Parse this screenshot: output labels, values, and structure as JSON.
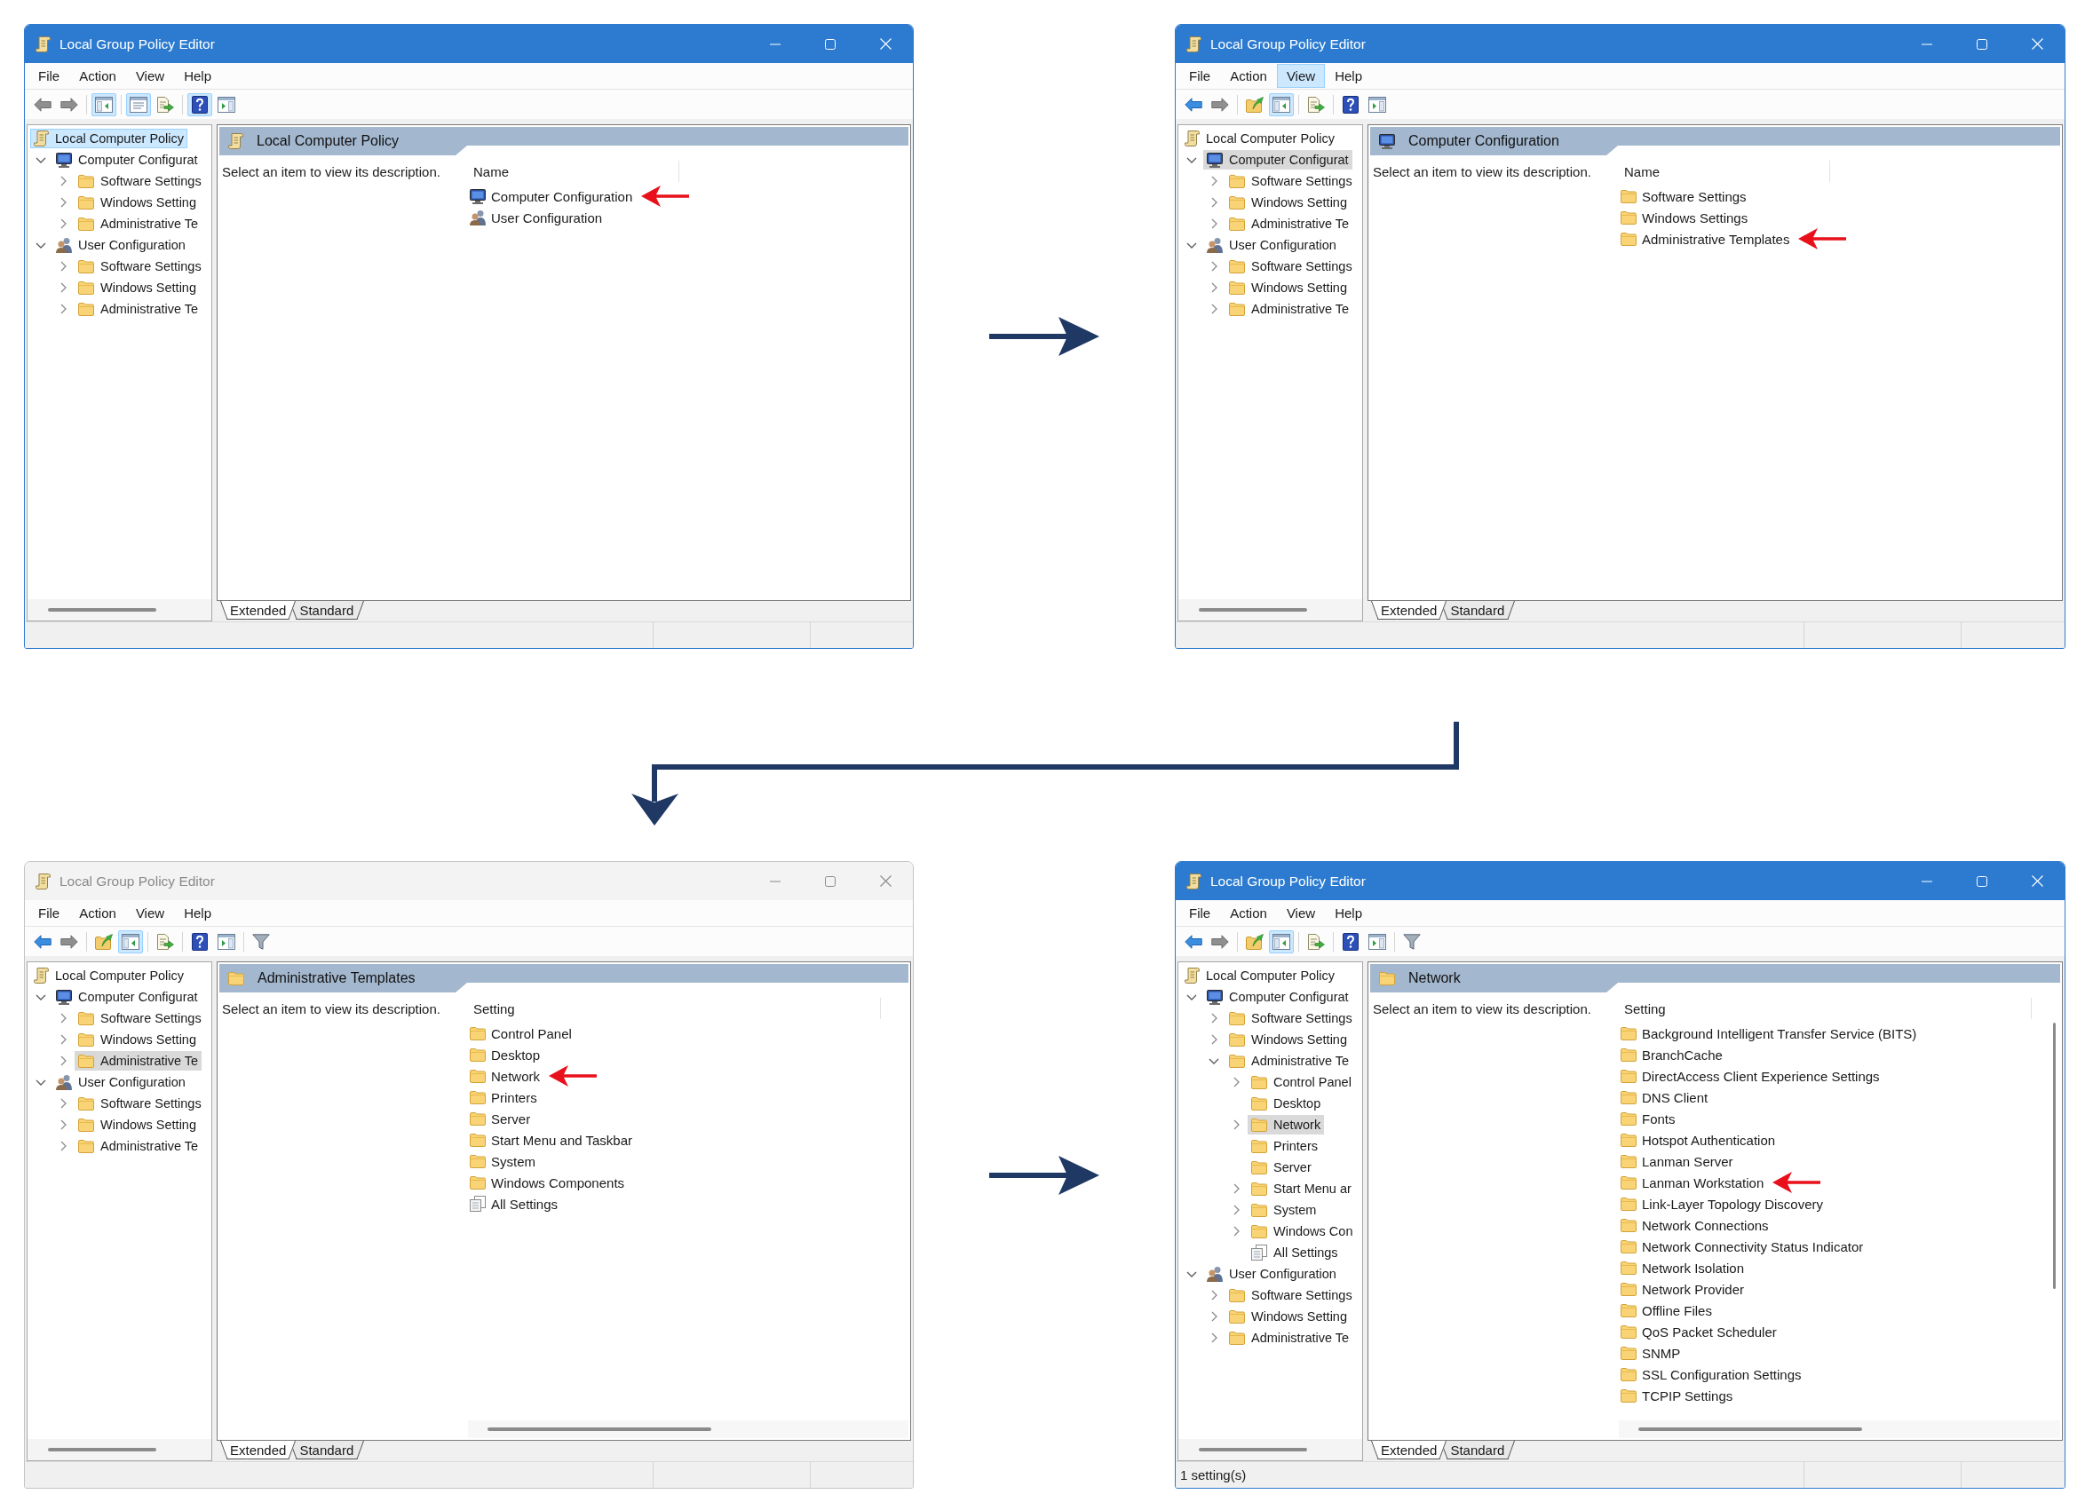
{
  "windows": [
    {
      "active": true,
      "title": "Local Group Policy Editor",
      "menu": [
        {
          "label": "File",
          "highlighted": false
        },
        {
          "label": "Action",
          "highlighted": false
        },
        {
          "label": "View",
          "highlighted": false
        },
        {
          "label": "Help",
          "highlighted": false
        }
      ],
      "toolbar": [
        {
          "kind": "back",
          "enabled": false,
          "pressed": false
        },
        {
          "kind": "forward",
          "enabled": false,
          "pressed": false
        },
        {
          "kind": "separator"
        },
        {
          "kind": "console-tree",
          "enabled": true,
          "pressed": true
        },
        {
          "kind": "separator"
        },
        {
          "kind": "properties",
          "enabled": true,
          "pressed": true
        },
        {
          "kind": "export",
          "enabled": true,
          "pressed": false
        },
        {
          "kind": "separator"
        },
        {
          "kind": "help",
          "enabled": true,
          "pressed": true
        },
        {
          "kind": "action-pane",
          "enabled": true,
          "pressed": false
        }
      ],
      "tree": {
        "focused": true,
        "items": [
          {
            "label": "Local Computer Policy",
            "kind": "policy",
            "expandable": false,
            "selected": true,
            "children": [
              {
                "label": "Computer Configurat",
                "kind": "computer",
                "expandable": true,
                "expanded": true,
                "selected": false,
                "children": [
                  {
                    "label": "Software Settings",
                    "kind": "folder",
                    "expandable": true,
                    "expanded": false,
                    "selected": false
                  },
                  {
                    "label": "Windows Setting",
                    "kind": "folder",
                    "expandable": true,
                    "expanded": false,
                    "selected": false
                  },
                  {
                    "label": "Administrative Te",
                    "kind": "folder",
                    "expandable": true,
                    "expanded": false,
                    "selected": false
                  }
                ]
              },
              {
                "label": "User Configuration",
                "kind": "user",
                "expandable": true,
                "expanded": true,
                "selected": false,
                "children": [
                  {
                    "label": "Software Settings",
                    "kind": "folder",
                    "expandable": true,
                    "expanded": false,
                    "selected": false
                  },
                  {
                    "label": "Windows Setting",
                    "kind": "folder",
                    "expandable": true,
                    "expanded": false,
                    "selected": false
                  },
                  {
                    "label": "Administrative Te",
                    "kind": "folder",
                    "expandable": true,
                    "expanded": false,
                    "selected": false
                  }
                ]
              }
            ]
          }
        ]
      },
      "pane": {
        "kind": "policy",
        "title": "Local Computer Policy",
        "description": "Select an item to view its description.",
        "column": "Name",
        "scroll_horizontal": false,
        "scroll_vertical": false,
        "items": [
          {
            "kind": "computer",
            "label": "Computer Configuration",
            "arrow": true
          },
          {
            "kind": "user",
            "label": "User Configuration",
            "arrow": false
          }
        ]
      },
      "tabs": [
        {
          "label": "Extended",
          "selected": true
        },
        {
          "label": "Standard",
          "selected": false
        }
      ]
    },
    {
      "active": true,
      "title": "Local Group Policy Editor",
      "menu": [
        {
          "label": "File",
          "highlighted": false
        },
        {
          "label": "Action",
          "highlighted": false
        },
        {
          "label": "View",
          "highlighted": true
        },
        {
          "label": "Help",
          "highlighted": false
        }
      ],
      "toolbar": [
        {
          "kind": "back",
          "enabled": true,
          "pressed": false
        },
        {
          "kind": "forward",
          "enabled": false,
          "pressed": false
        },
        {
          "kind": "separator"
        },
        {
          "kind": "up",
          "enabled": true,
          "pressed": false
        },
        {
          "kind": "console-tree",
          "enabled": true,
          "pressed": true
        },
        {
          "kind": "separator"
        },
        {
          "kind": "export",
          "enabled": true,
          "pressed": false
        },
        {
          "kind": "separator"
        },
        {
          "kind": "help",
          "enabled": true,
          "pressed": false
        },
        {
          "kind": "action-pane",
          "enabled": true,
          "pressed": false
        }
      ],
      "tree": {
        "focused": false,
        "items": [
          {
            "label": "Local Computer Policy",
            "kind": "policy",
            "expandable": false,
            "selected": false,
            "children": [
              {
                "label": "Computer Configurat",
                "kind": "computer",
                "expandable": true,
                "expanded": true,
                "selected": true,
                "children": [
                  {
                    "label": "Software Settings",
                    "kind": "folder",
                    "expandable": true,
                    "expanded": false,
                    "selected": false
                  },
                  {
                    "label": "Windows Setting",
                    "kind": "folder",
                    "expandable": true,
                    "expanded": false,
                    "selected": false
                  },
                  {
                    "label": "Administrative Te",
                    "kind": "folder",
                    "expandable": true,
                    "expanded": false,
                    "selected": false
                  }
                ]
              },
              {
                "label": "User Configuration",
                "kind": "user",
                "expandable": true,
                "expanded": true,
                "selected": false,
                "children": [
                  {
                    "label": "Software Settings",
                    "kind": "folder",
                    "expandable": true,
                    "expanded": false,
                    "selected": false
                  },
                  {
                    "label": "Windows Setting",
                    "kind": "folder",
                    "expandable": true,
                    "expanded": false,
                    "selected": false
                  },
                  {
                    "label": "Administrative Te",
                    "kind": "folder",
                    "expandable": true,
                    "expanded": false,
                    "selected": false
                  }
                ]
              }
            ]
          }
        ]
      },
      "pane": {
        "kind": "computer",
        "title": "Computer Configuration",
        "description": "Select an item to view its description.",
        "column": "Name",
        "scroll_horizontal": false,
        "scroll_vertical": false,
        "items": [
          {
            "kind": "folder",
            "label": "Software Settings",
            "arrow": false
          },
          {
            "kind": "folder",
            "label": "Windows Settings",
            "arrow": false
          },
          {
            "kind": "folder",
            "label": "Administrative Templates",
            "arrow": true
          }
        ]
      },
      "tabs": [
        {
          "label": "Extended",
          "selected": true
        },
        {
          "label": "Standard",
          "selected": false
        }
      ]
    },
    {
      "active": false,
      "title": "Local Group Policy Editor",
      "menu": [
        {
          "label": "File",
          "highlighted": false
        },
        {
          "label": "Action",
          "highlighted": false
        },
        {
          "label": "View",
          "highlighted": false
        },
        {
          "label": "Help",
          "highlighted": false
        }
      ],
      "toolbar": [
        {
          "kind": "back",
          "enabled": true,
          "pressed": false
        },
        {
          "kind": "forward",
          "enabled": false,
          "pressed": false
        },
        {
          "kind": "separator"
        },
        {
          "kind": "up",
          "enabled": true,
          "pressed": false
        },
        {
          "kind": "console-tree",
          "enabled": true,
          "pressed": true
        },
        {
          "kind": "separator"
        },
        {
          "kind": "export",
          "enabled": true,
          "pressed": false
        },
        {
          "kind": "separator"
        },
        {
          "kind": "help",
          "enabled": true,
          "pressed": false
        },
        {
          "kind": "action-pane",
          "enabled": true,
          "pressed": false
        },
        {
          "kind": "separator"
        },
        {
          "kind": "filter",
          "enabled": true,
          "pressed": false
        }
      ],
      "tree": {
        "focused": false,
        "items": [
          {
            "label": "Local Computer Policy",
            "kind": "policy",
            "expandable": false,
            "selected": false,
            "children": [
              {
                "label": "Computer Configurat",
                "kind": "computer",
                "expandable": true,
                "expanded": true,
                "selected": false,
                "children": [
                  {
                    "label": "Software Settings",
                    "kind": "folder",
                    "expandable": true,
                    "expanded": false,
                    "selected": false
                  },
                  {
                    "label": "Windows Setting",
                    "kind": "folder",
                    "expandable": true,
                    "expanded": false,
                    "selected": false
                  },
                  {
                    "label": "Administrative Te",
                    "kind": "folder",
                    "expandable": true,
                    "expanded": false,
                    "selected": true
                  }
                ]
              },
              {
                "label": "User Configuration",
                "kind": "user",
                "expandable": true,
                "expanded": true,
                "selected": false,
                "children": [
                  {
                    "label": "Software Settings",
                    "kind": "folder",
                    "expandable": true,
                    "expanded": false,
                    "selected": false
                  },
                  {
                    "label": "Windows Setting",
                    "kind": "folder",
                    "expandable": true,
                    "expanded": false,
                    "selected": false
                  },
                  {
                    "label": "Administrative Te",
                    "kind": "folder",
                    "expandable": true,
                    "expanded": false,
                    "selected": false
                  }
                ]
              }
            ]
          }
        ]
      },
      "pane": {
        "kind": "folder",
        "title": "Administrative Templates",
        "description": "Select an item to view its description.",
        "column": "Setting",
        "scroll_horizontal": true,
        "scroll_vertical": false,
        "items": [
          {
            "kind": "folder",
            "label": "Control Panel",
            "arrow": false
          },
          {
            "kind": "folder",
            "label": "Desktop",
            "arrow": false
          },
          {
            "kind": "folder",
            "label": "Network",
            "arrow": true
          },
          {
            "kind": "folder",
            "label": "Printers",
            "arrow": false
          },
          {
            "kind": "folder",
            "label": "Server",
            "arrow": false
          },
          {
            "kind": "folder",
            "label": "Start Menu and Taskbar",
            "arrow": false
          },
          {
            "kind": "folder",
            "label": "System",
            "arrow": false
          },
          {
            "kind": "folder",
            "label": "Windows Components",
            "arrow": false
          },
          {
            "kind": "all-settings",
            "label": "All Settings",
            "arrow": false
          }
        ]
      },
      "tabs": [
        {
          "label": "Extended",
          "selected": true
        },
        {
          "label": "Standard",
          "selected": false
        }
      ]
    },
    {
      "active": true,
      "title": "Local Group Policy Editor",
      "menu": [
        {
          "label": "File",
          "highlighted": false
        },
        {
          "label": "Action",
          "highlighted": false
        },
        {
          "label": "View",
          "highlighted": false
        },
        {
          "label": "Help",
          "highlighted": false
        }
      ],
      "toolbar": [
        {
          "kind": "back",
          "enabled": true,
          "pressed": false
        },
        {
          "kind": "forward",
          "enabled": false,
          "pressed": false
        },
        {
          "kind": "separator"
        },
        {
          "kind": "up",
          "enabled": true,
          "pressed": false
        },
        {
          "kind": "console-tree",
          "enabled": true,
          "pressed": true
        },
        {
          "kind": "separator"
        },
        {
          "kind": "export",
          "enabled": true,
          "pressed": false
        },
        {
          "kind": "separator"
        },
        {
          "kind": "help",
          "enabled": true,
          "pressed": false
        },
        {
          "kind": "action-pane",
          "enabled": true,
          "pressed": false
        },
        {
          "kind": "separator"
        },
        {
          "kind": "filter",
          "enabled": true,
          "pressed": false
        }
      ],
      "tree": {
        "focused": false,
        "items": [
          {
            "label": "Local Computer Policy",
            "kind": "policy",
            "expandable": false,
            "selected": false,
            "children": [
              {
                "label": "Computer Configurat",
                "kind": "computer",
                "expandable": true,
                "expanded": true,
                "selected": false,
                "children": [
                  {
                    "label": "Software Settings",
                    "kind": "folder",
                    "expandable": true,
                    "expanded": false,
                    "selected": false
                  },
                  {
                    "label": "Windows Setting",
                    "kind": "folder",
                    "expandable": true,
                    "expanded": false,
                    "selected": false
                  },
                  {
                    "label": "Administrative Te",
                    "kind": "folder",
                    "expandable": true,
                    "expanded": true,
                    "selected": false,
                    "children": [
                      {
                        "label": "Control Panel",
                        "kind": "folder",
                        "expandable": true,
                        "expanded": false,
                        "selected": false
                      },
                      {
                        "label": "Desktop",
                        "kind": "folder",
                        "expandable": false,
                        "selected": false
                      },
                      {
                        "label": "Network",
                        "kind": "folder",
                        "expandable": true,
                        "expanded": false,
                        "selected": true
                      },
                      {
                        "label": "Printers",
                        "kind": "folder",
                        "expandable": false,
                        "selected": false
                      },
                      {
                        "label": "Server",
                        "kind": "folder",
                        "expandable": false,
                        "selected": false
                      },
                      {
                        "label": "Start Menu ar",
                        "kind": "folder",
                        "expandable": true,
                        "expanded": false,
                        "selected": false
                      },
                      {
                        "label": "System",
                        "kind": "folder",
                        "expandable": true,
                        "expanded": false,
                        "selected": false
                      },
                      {
                        "label": "Windows Con",
                        "kind": "folder",
                        "expandable": true,
                        "expanded": false,
                        "selected": false
                      },
                      {
                        "label": "All Settings",
                        "kind": "all-settings",
                        "expandable": false,
                        "selected": false
                      }
                    ]
                  }
                ]
              },
              {
                "label": "User Configuration",
                "kind": "user",
                "expandable": true,
                "expanded": true,
                "selected": false,
                "children": [
                  {
                    "label": "Software Settings",
                    "kind": "folder",
                    "expandable": true,
                    "expanded": false,
                    "selected": false
                  },
                  {
                    "label": "Windows Setting",
                    "kind": "folder",
                    "expandable": true,
                    "expanded": false,
                    "selected": false
                  },
                  {
                    "label": "Administrative Te",
                    "kind": "folder",
                    "expandable": true,
                    "expanded": false,
                    "selected": false
                  }
                ]
              }
            ]
          }
        ]
      },
      "pane": {
        "kind": "folder",
        "title": "Network",
        "description": "Select an item to view its description.",
        "column": "Setting",
        "scroll_horizontal": true,
        "scroll_vertical": true,
        "items": [
          {
            "kind": "folder",
            "label": "Background Intelligent Transfer Service (BITS)",
            "arrow": false
          },
          {
            "kind": "folder",
            "label": "BranchCache",
            "arrow": false
          },
          {
            "kind": "folder",
            "label": "DirectAccess Client Experience Settings",
            "arrow": false
          },
          {
            "kind": "folder",
            "label": "DNS Client",
            "arrow": false
          },
          {
            "kind": "folder",
            "label": "Fonts",
            "arrow": false
          },
          {
            "kind": "folder",
            "label": "Hotspot Authentication",
            "arrow": false
          },
          {
            "kind": "folder",
            "label": "Lanman Server",
            "arrow": false
          },
          {
            "kind": "folder",
            "label": "Lanman Workstation",
            "arrow": true
          },
          {
            "kind": "folder",
            "label": "Link-Layer Topology Discovery",
            "arrow": false
          },
          {
            "kind": "folder",
            "label": "Network Connections",
            "arrow": false
          },
          {
            "kind": "folder",
            "label": "Network Connectivity Status Indicator",
            "arrow": false
          },
          {
            "kind": "folder",
            "label": "Network Isolation",
            "arrow": false
          },
          {
            "kind": "folder",
            "label": "Network Provider",
            "arrow": false
          },
          {
            "kind": "folder",
            "label": "Offline Files",
            "arrow": false
          },
          {
            "kind": "folder",
            "label": "QoS Packet Scheduler",
            "arrow": false
          },
          {
            "kind": "folder",
            "label": "SNMP",
            "arrow": false
          },
          {
            "kind": "folder",
            "label": "SSL Configuration Settings",
            "arrow": false
          },
          {
            "kind": "folder",
            "label": "TCPIP Settings",
            "arrow": false
          }
        ]
      },
      "tabs": [
        {
          "label": "Extended",
          "selected": true
        },
        {
          "label": "Standard",
          "selected": false
        }
      ],
      "status": "1 setting(s)"
    }
  ]
}
